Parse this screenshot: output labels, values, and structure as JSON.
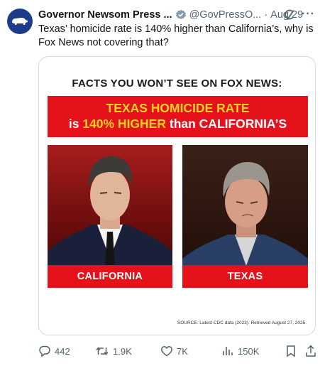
{
  "author": {
    "name": "Governor Newsom Press ...",
    "handle": "@GovPressO...",
    "separator": "·",
    "time": "Aug 29",
    "more": "···"
  },
  "tweet": {
    "text": "Texas’ homicide rate is 140% higher than California’s, why is Fox News not covering that?"
  },
  "media": {
    "title": "FACTS YOU WON’T SEE ON FOX NEWS:",
    "banner_line1": "TEXAS HOMICIDE RATE",
    "banner_line2_prefix": "is ",
    "banner_line2_highlight": "140% HIGHER",
    "banner_line2_suffix": " than CALIFORNIA’S",
    "left_label": "CALIFORNIA",
    "right_label": "TEXAS",
    "source": "SOURCE: Latest CDC data (2023). Retrieved August 27, 2025.",
    "accent_red": "#e5111b",
    "accent_yellow": "#ffd21f"
  },
  "actions": {
    "replies": "442",
    "reposts": "1.9K",
    "likes": "7K",
    "views": "150K"
  },
  "icons": [
    "bear-avatar-icon",
    "verified-badge-icon",
    "grok-icon",
    "more-icon",
    "reply-icon",
    "repost-icon",
    "like-icon",
    "views-icon",
    "bookmark-icon",
    "share-icon"
  ]
}
